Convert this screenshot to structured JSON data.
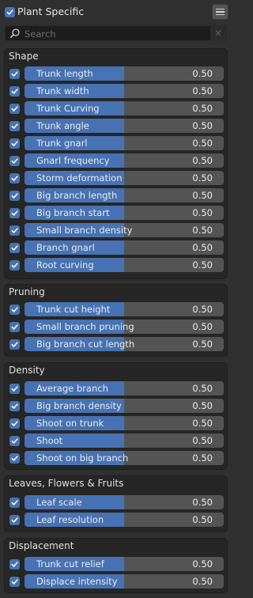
{
  "header": {
    "title": "Plant Specific",
    "enabled": true
  },
  "search": {
    "placeholder": "Search"
  },
  "sections": [
    {
      "title": "Shape",
      "items": [
        {
          "label": "Trunk length",
          "value": "0.50",
          "checked": true
        },
        {
          "label": "Trunk width",
          "value": "0.50",
          "checked": true
        },
        {
          "label": "Trunk Curving",
          "value": "0.50",
          "checked": true
        },
        {
          "label": "Trunk angle",
          "value": "0.50",
          "checked": true
        },
        {
          "label": "Trunk gnarl",
          "value": "0.50",
          "checked": true
        },
        {
          "label": "Gnarl frequency",
          "value": "0.50",
          "checked": true
        },
        {
          "label": "Storm deformation",
          "value": "0.50",
          "checked": true
        },
        {
          "label": "Big branch length",
          "value": "0.50",
          "checked": true
        },
        {
          "label": "Big branch start",
          "value": "0.50",
          "checked": true
        },
        {
          "label": "Small branch density",
          "value": "0.50",
          "checked": true
        },
        {
          "label": "Branch gnarl",
          "value": "0.50",
          "checked": true
        },
        {
          "label": "Root curving",
          "value": "0.50",
          "checked": true
        }
      ]
    },
    {
      "title": "Pruning",
      "items": [
        {
          "label": "Trunk cut height",
          "value": "0.50",
          "checked": true
        },
        {
          "label": "Small branch pruning",
          "value": "0.50",
          "checked": true
        },
        {
          "label": "Big branch cut length",
          "value": "0.50",
          "checked": true
        }
      ]
    },
    {
      "title": "Density",
      "items": [
        {
          "label": "Average branch",
          "value": "0.50",
          "checked": true
        },
        {
          "label": "Big branch density",
          "value": "0.50",
          "checked": true
        },
        {
          "label": "Shoot on trunk",
          "value": "0.50",
          "checked": true
        },
        {
          "label": "Shoot",
          "value": "0.50",
          "checked": true
        },
        {
          "label": "Shoot on big branch",
          "value": "0.50",
          "checked": true
        }
      ]
    },
    {
      "title": "Leaves, Flowers & Fruits",
      "items": [
        {
          "label": "Leaf scale",
          "value": "0.50",
          "checked": true
        },
        {
          "label": "Leaf resolution",
          "value": "0.50",
          "checked": true
        }
      ]
    },
    {
      "title": "Displacement",
      "items": [
        {
          "label": "Trunk cut relief",
          "value": "0.50",
          "checked": true
        },
        {
          "label": "Displace intensity",
          "value": "0.50",
          "checked": true
        }
      ]
    }
  ],
  "colors": {
    "accent": "#4772b3",
    "slider_bg": "#545454",
    "panel_bg": "#262626",
    "window_bg": "#303030"
  }
}
